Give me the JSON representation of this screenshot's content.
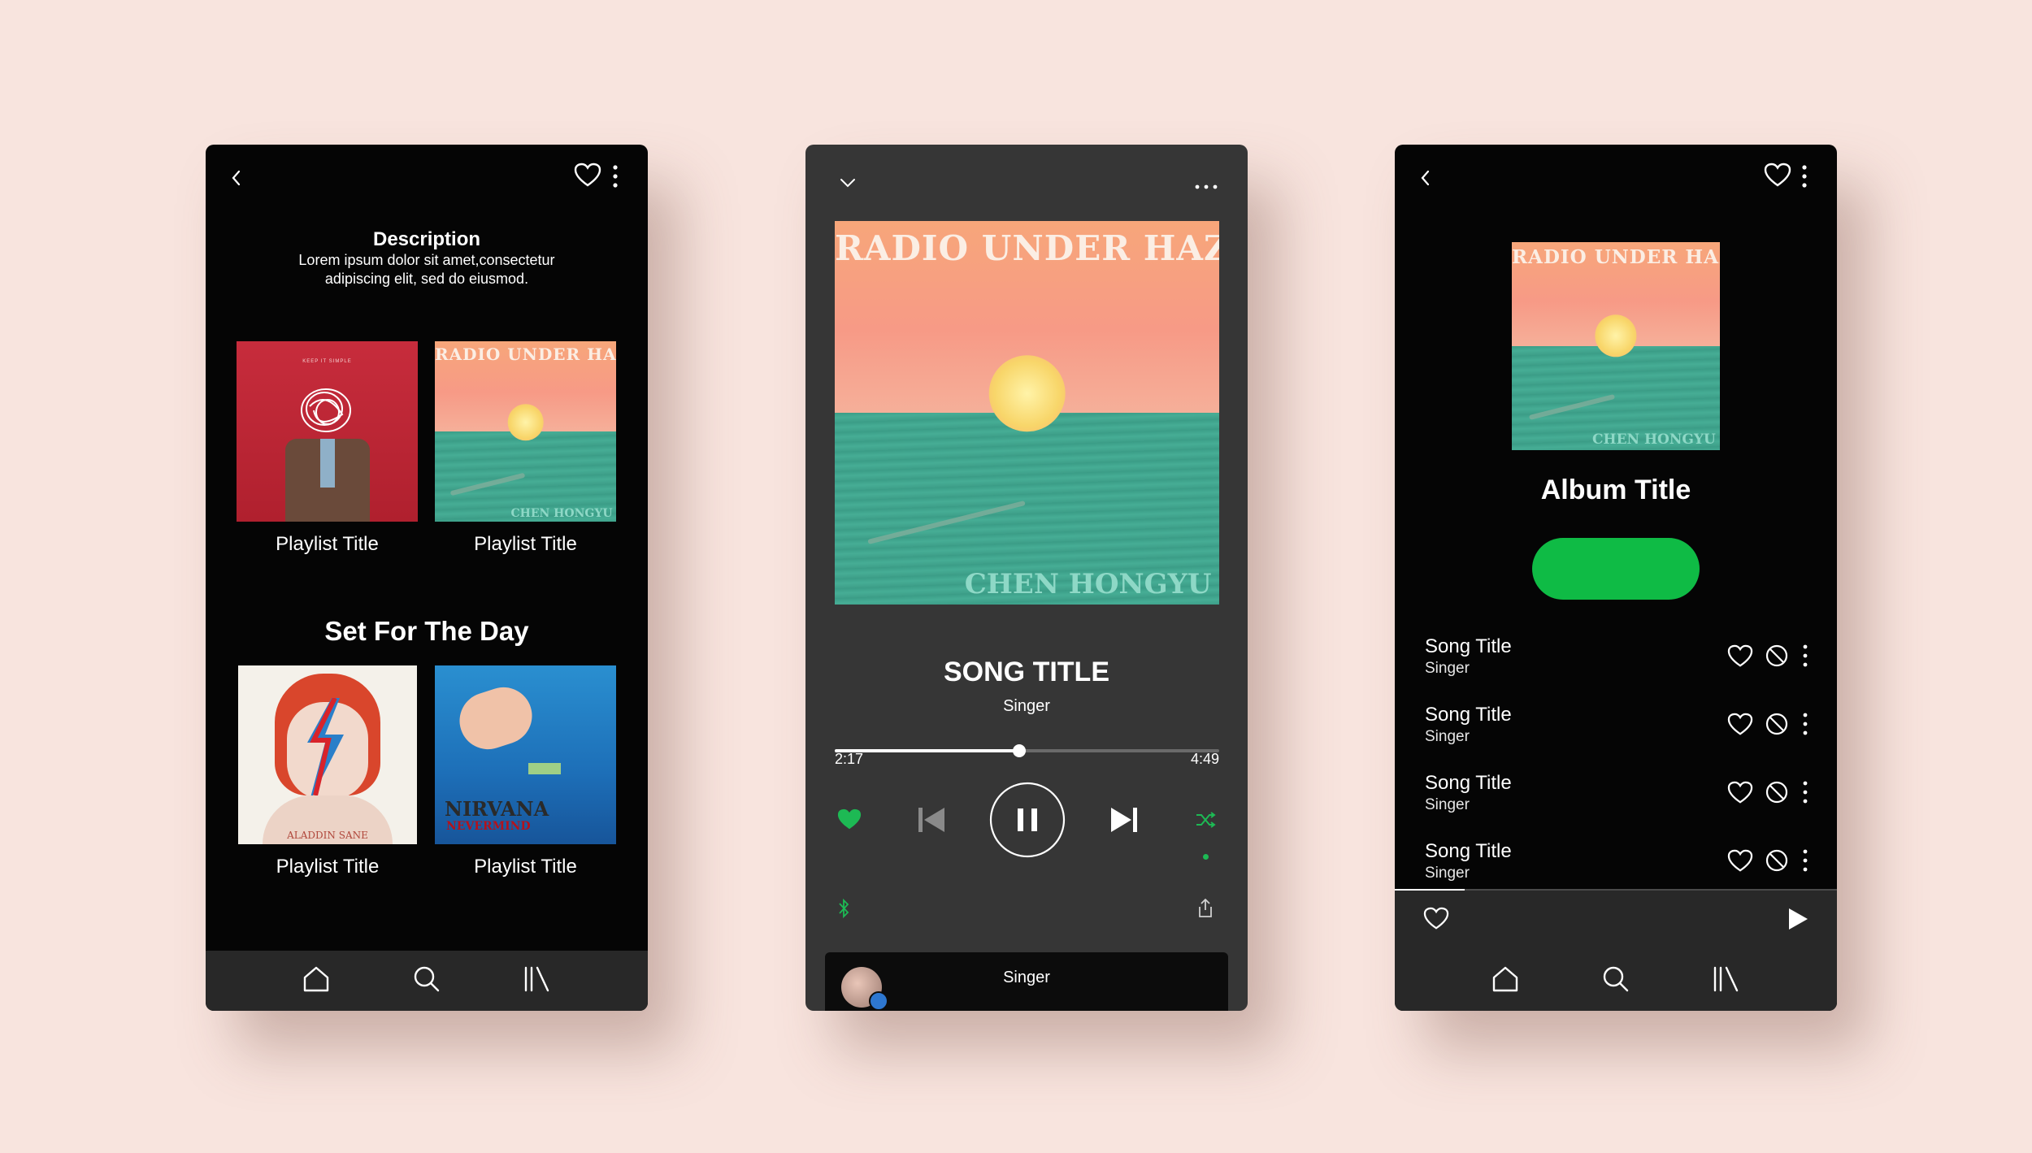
{
  "screen1": {
    "description_title": "Description",
    "description_line1": "Lorem ipsum dolor sit amet,consectetur",
    "description_line2": "adipiscing elit, sed do eiusmod.",
    "playlists_top": [
      {
        "label": "Playlist Title",
        "art_text": "KEEP IT SIMPLE"
      },
      {
        "label": "Playlist Title",
        "art_top": "RADIO UNDER HAZE",
        "art_bottom": "CHEN HONGYU"
      }
    ],
    "section_title": "Set For The Day",
    "playlists_bottom": [
      {
        "label": "Playlist Title",
        "art_text": "ALADDIN SANE"
      },
      {
        "label": "Playlist Title",
        "art_text": "NIRVANA",
        "art_sub": "NEVERMIND"
      }
    ]
  },
  "screen2": {
    "art_top": "RADIO UNDER HAZE",
    "art_bottom": "CHEN HONGYU",
    "song_title": "SONG TITLE",
    "singer": "Singer",
    "elapsed": "2:17",
    "duration": "4:49",
    "progress": 0.48,
    "bottom_singer": "Singer"
  },
  "screen3": {
    "art_top": "RADIO UNDER HAZE",
    "art_bottom": "CHEN HONGYU",
    "album_title": "Album Title",
    "songs": [
      {
        "title": "Song Title",
        "singer": "Singer"
      },
      {
        "title": "Song Title",
        "singer": "Singer"
      },
      {
        "title": "Song Title",
        "singer": "Singer"
      },
      {
        "title": "Song Title",
        "singer": "Singer"
      }
    ]
  },
  "colors": {
    "background": "#f8e4de",
    "phone_dark": "#050505",
    "player_gray": "#363636",
    "tab_bar": "#282828",
    "accent_green": "#1db954",
    "button_green": "#0fbb45"
  },
  "icons": {
    "back": "chevron-left-icon",
    "collapse": "chevron-down-icon",
    "like": "heart-icon",
    "more": "more-vertical-icon",
    "more_h": "more-horizontal-icon",
    "home": "home-icon",
    "search": "search-icon",
    "library": "library-icon",
    "prev": "skip-previous-icon",
    "pause": "pause-icon",
    "next": "skip-next-icon",
    "shuffle": "shuffle-icon",
    "bluetooth": "bluetooth-icon",
    "share": "share-icon",
    "play": "play-icon",
    "block": "block-icon"
  }
}
